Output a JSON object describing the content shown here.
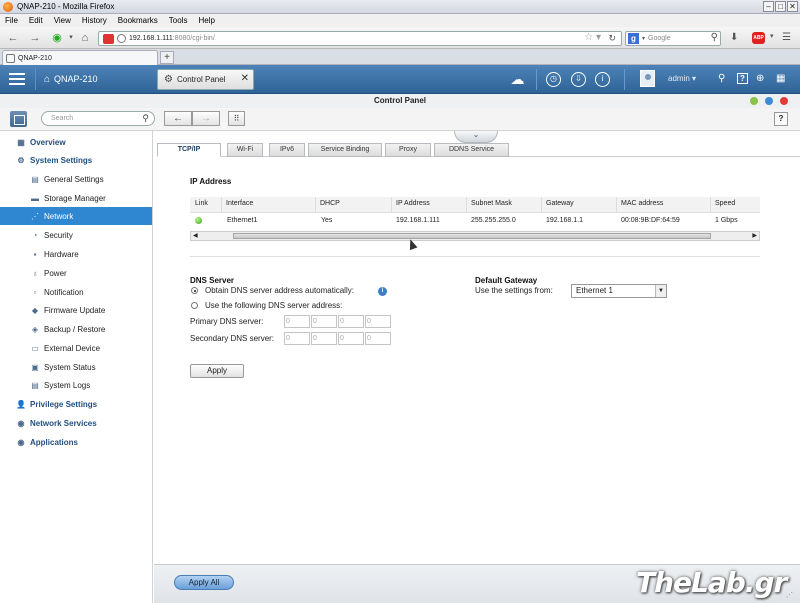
{
  "window": {
    "title": "QNAP-210 - Mozilla Firefox"
  },
  "menu": [
    "File",
    "Edit",
    "View",
    "History",
    "Bookmarks",
    "Tools",
    "Help"
  ],
  "browser": {
    "url_host": "192.168.1.111",
    "url_rest": ":8080/cgi-bin/",
    "search_placeholder": "Google",
    "tab_label": "QNAP-210"
  },
  "qnap": {
    "home_label": "QNAP-210",
    "app_tab": "Control Panel",
    "user": "admin"
  },
  "panel": {
    "title": "Control Panel",
    "search_placeholder": "Search"
  },
  "sidebar": {
    "items": [
      {
        "label": "Overview",
        "level": "top",
        "icon": "overview-icon",
        "glyph": "▦"
      },
      {
        "label": "System Settings",
        "level": "top",
        "icon": "system-settings-icon",
        "glyph": "⚙"
      },
      {
        "label": "General Settings",
        "level": "sub",
        "icon": "general-settings-icon",
        "glyph": "▤"
      },
      {
        "label": "Storage Manager",
        "level": "sub",
        "icon": "storage-manager-icon",
        "glyph": "▬"
      },
      {
        "label": "Network",
        "level": "sub",
        "icon": "network-icon",
        "glyph": "⋰",
        "active": true
      },
      {
        "label": "Security",
        "level": "sub",
        "icon": "security-icon",
        "glyph": "◔"
      },
      {
        "label": "Hardware",
        "level": "sub",
        "icon": "hardware-icon",
        "glyph": "▪"
      },
      {
        "label": "Power",
        "level": "sub",
        "icon": "power-icon",
        "glyph": "♁"
      },
      {
        "label": "Notification",
        "level": "sub",
        "icon": "notification-icon",
        "glyph": "▫"
      },
      {
        "label": "Firmware Update",
        "level": "sub",
        "icon": "firmware-update-icon",
        "glyph": "◆"
      },
      {
        "label": "Backup / Restore",
        "level": "sub",
        "icon": "backup-restore-icon",
        "glyph": "◈"
      },
      {
        "label": "External Device",
        "level": "sub",
        "icon": "external-device-icon",
        "glyph": "▭"
      },
      {
        "label": "System Status",
        "level": "sub",
        "icon": "system-status-icon",
        "glyph": "▣"
      },
      {
        "label": "System Logs",
        "level": "sub",
        "icon": "system-logs-icon",
        "glyph": "▤"
      },
      {
        "label": "Privilege Settings",
        "level": "top",
        "icon": "privilege-settings-icon",
        "glyph": "👤"
      },
      {
        "label": "Network Services",
        "level": "top",
        "icon": "network-services-icon",
        "glyph": "◉"
      },
      {
        "label": "Applications",
        "level": "top",
        "icon": "applications-icon",
        "glyph": "◉"
      }
    ]
  },
  "tabs": [
    "TCP/IP",
    "Wi-Fi",
    "IPv6",
    "Service Binding",
    "Proxy",
    "DDNS Service"
  ],
  "ip_address": {
    "title": "IP Address",
    "columns": [
      "Link",
      "Interface",
      "DHCP",
      "IP Address",
      "Subnet Mask",
      "Gateway",
      "MAC address",
      "Speed"
    ],
    "rows": [
      {
        "interface": "Ethernet1",
        "dhcp": "Yes",
        "ip": "192.168.1.111",
        "mask": "255.255.255.0",
        "gateway": "192.168.1.1",
        "mac": "00:08:9B:DF:64:59",
        "speed": "1 Gbps"
      }
    ]
  },
  "dns": {
    "title": "DNS Server",
    "auto_label": "Obtain DNS server address automatically:",
    "manual_label": "Use the following DNS server address:",
    "primary_label": "Primary DNS server:",
    "secondary_label": "Secondary DNS server:",
    "primary": [
      "0",
      "0",
      "0",
      "0"
    ],
    "secondary": [
      "0",
      "0",
      "0",
      "0"
    ]
  },
  "gateway": {
    "title": "Default Gateway",
    "use_label": "Use the settings from:",
    "selected": "Ethernet 1"
  },
  "buttons": {
    "apply": "Apply",
    "apply_all": "Apply All"
  },
  "watermark": "TheLab.gr",
  "colors": {
    "accent": "#2f87d2",
    "qnap_bar": "#3a6fa6"
  }
}
